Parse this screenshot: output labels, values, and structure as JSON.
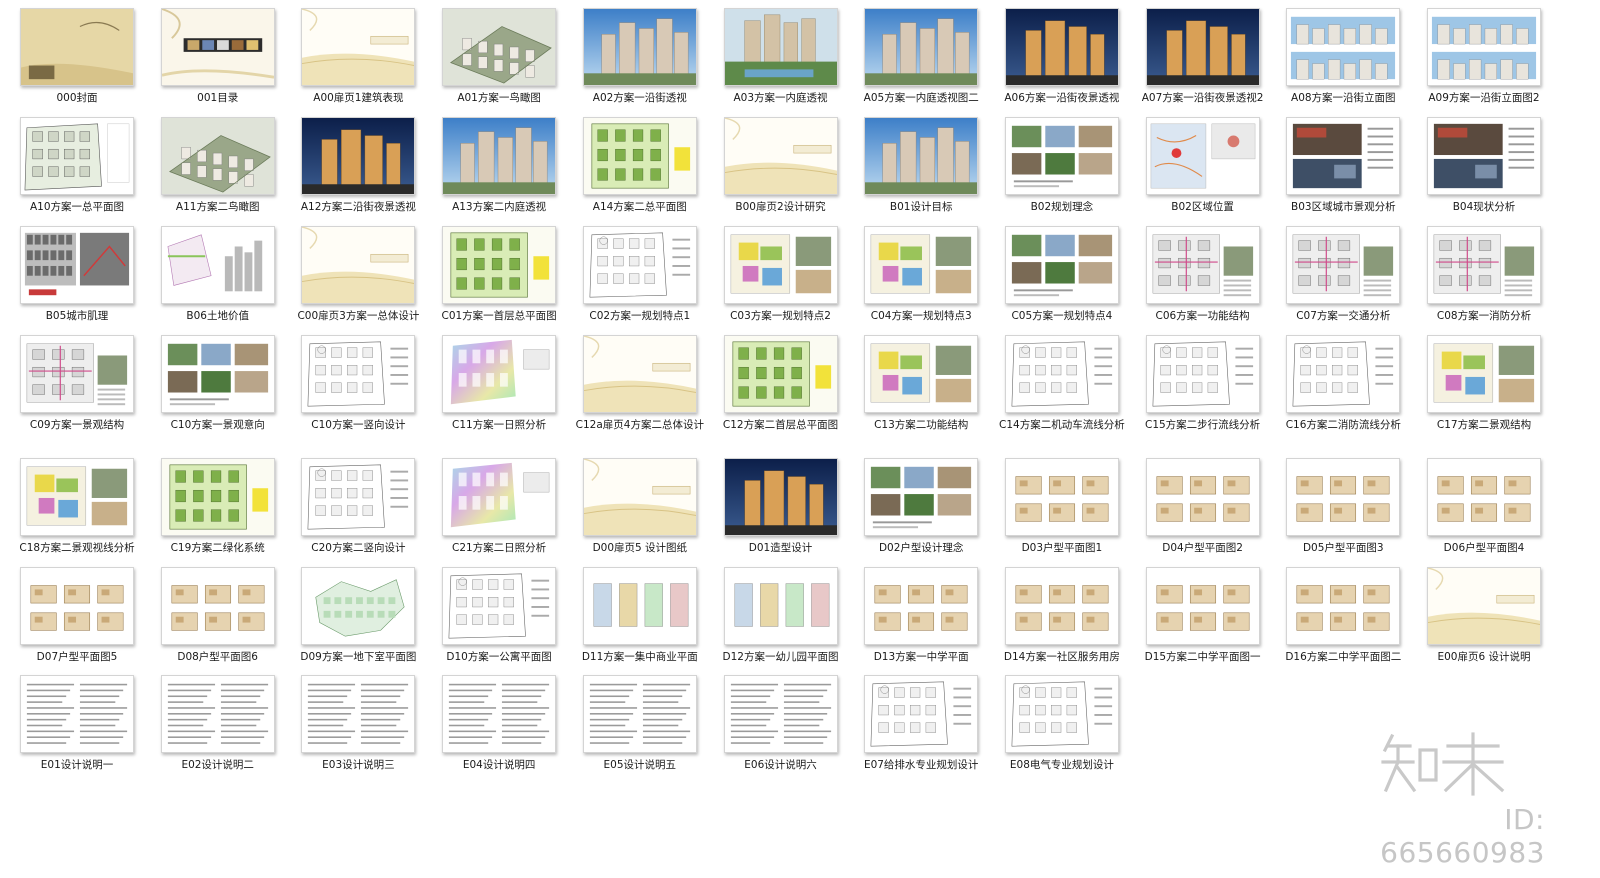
{
  "rows": [
    [
      {
        "label": "000封面",
        "kind": "cover"
      },
      {
        "label": "001目录",
        "kind": "toc"
      },
      {
        "label": "A00扉页1建筑表现",
        "kind": "divider"
      },
      {
        "label": "A01方案一鸟瞰图",
        "kind": "aerial"
      },
      {
        "label": "A02方案一沿街透视",
        "kind": "tower-day"
      },
      {
        "label": "A03方案一内庭透视",
        "kind": "tower-garden"
      },
      {
        "label": "A05方案一内庭透视图二",
        "kind": "tower-day"
      },
      {
        "label": "A06方案一沿街夜景透视",
        "kind": "tower-night"
      },
      {
        "label": "A07方案一沿街夜景透视2",
        "kind": "tower-night"
      },
      {
        "label": "A08方案一沿街立面图",
        "kind": "elevation"
      },
      {
        "label": "A09方案一沿街立面图2",
        "kind": "elevation"
      }
    ],
    [
      {
        "label": "A10方案一总平面图",
        "kind": "siteplan"
      },
      {
        "label": "A11方案二鸟瞰图",
        "kind": "aerial"
      },
      {
        "label": "A12方案二沿街夜景透视",
        "kind": "tower-night"
      },
      {
        "label": "A13方案二内庭透视",
        "kind": "tower-day"
      },
      {
        "label": "A14方案二总平面图",
        "kind": "siteplan-green"
      },
      {
        "label": "B00扉页2设计研究",
        "kind": "divider"
      },
      {
        "label": "B01设计目标",
        "kind": "tower-day"
      },
      {
        "label": "B02规划理念",
        "kind": "photos"
      },
      {
        "label": "B02区域位置",
        "kind": "map"
      },
      {
        "label": "B03区域城市景观分析",
        "kind": "photos-dark"
      },
      {
        "label": "B04现状分析",
        "kind": "photos-dark"
      }
    ],
    [
      {
        "label": "B05城市肌理",
        "kind": "texture"
      },
      {
        "label": "B06土地价值",
        "kind": "landvalue"
      },
      {
        "label": "C00扉页3方案一总体设计",
        "kind": "divider"
      },
      {
        "label": "C01方案一首层总平面图",
        "kind": "siteplan-green"
      },
      {
        "label": "C02方案一规划特点1",
        "kind": "lineplan"
      },
      {
        "label": "C03方案一规划特点2",
        "kind": "analysis-color"
      },
      {
        "label": "C04方案一规划特点3",
        "kind": "analysis-color"
      },
      {
        "label": "C05方案一规划特点4",
        "kind": "photos"
      },
      {
        "label": "C06方案一功能结构",
        "kind": "analysis-plan"
      },
      {
        "label": "C07方案一交通分析",
        "kind": "analysis-plan"
      },
      {
        "label": "C08方案一消防分析",
        "kind": "analysis-plan"
      }
    ],
    [
      {
        "label": "C09方案一景观结构",
        "kind": "analysis-plan"
      },
      {
        "label": "C10方案一景观意向",
        "kind": "photos"
      },
      {
        "label": "C10方案一竖向设计",
        "kind": "lineplan"
      },
      {
        "label": "C11方案一日照分析",
        "kind": "sunlight"
      },
      {
        "label": "C12a扉页4方案二总体设计",
        "kind": "divider"
      },
      {
        "label": "C12方案二首层总平面图",
        "kind": "siteplan-green"
      },
      {
        "label": "C13方案二功能结构",
        "kind": "analysis-color"
      },
      {
        "label": "C14方案二机动车流线分析",
        "kind": "lineplan"
      },
      {
        "label": "C15方案二步行流线分析",
        "kind": "lineplan"
      },
      {
        "label": "C16方案二消防流线分析",
        "kind": "lineplan"
      },
      {
        "label": "C17方案二景观结构",
        "kind": "analysis-color"
      }
    ],
    [
      {
        "label": "C18方案二景观视线分析",
        "kind": "analysis-color"
      },
      {
        "label": "C19方案二绿化系统",
        "kind": "siteplan-green"
      },
      {
        "label": "C20方案二竖向设计",
        "kind": "lineplan"
      },
      {
        "label": "C21方案二日照分析",
        "kind": "sunlight"
      },
      {
        "label": "D00扉页5 设计图纸",
        "kind": "divider"
      },
      {
        "label": "D01造型设计",
        "kind": "tower-night"
      },
      {
        "label": "D02户型设计理念",
        "kind": "photos"
      },
      {
        "label": "D03户型平面图1",
        "kind": "floorplan"
      },
      {
        "label": "D04户型平面图2",
        "kind": "floorplan"
      },
      {
        "label": "D05户型平面图3",
        "kind": "floorplan"
      },
      {
        "label": "D06户型平面图4",
        "kind": "floorplan"
      }
    ],
    [
      {
        "label": "D07户型平面图5",
        "kind": "floorplan"
      },
      {
        "label": "D08户型平面图6",
        "kind": "floorplan"
      },
      {
        "label": "D09方案一地下室平面图",
        "kind": "basement"
      },
      {
        "label": "D10方案一公寓平面图",
        "kind": "lineplan"
      },
      {
        "label": "D11方案一集中商业平面",
        "kind": "colorblocks"
      },
      {
        "label": "D12方案一幼儿园平面图",
        "kind": "colorblocks"
      },
      {
        "label": "D13方案一中学平面",
        "kind": "floorplan"
      },
      {
        "label": "D14方案一社区服务用房",
        "kind": "floorplan"
      },
      {
        "label": "D15方案二中学平面图一",
        "kind": "floorplan"
      },
      {
        "label": "D16方案二中学平面图二",
        "kind": "floorplan"
      },
      {
        "label": "E00扉页6 设计说明",
        "kind": "divider"
      }
    ],
    [
      {
        "label": "E01设计说明一",
        "kind": "text"
      },
      {
        "label": "E02设计说明二",
        "kind": "text"
      },
      {
        "label": "E03设计说明三",
        "kind": "text"
      },
      {
        "label": "E04设计说明四",
        "kind": "text"
      },
      {
        "label": "E05设计说明五",
        "kind": "text"
      },
      {
        "label": "E06设计说明六",
        "kind": "text"
      },
      {
        "label": "E07给排水专业规划设计",
        "kind": "lineplan"
      },
      {
        "label": "E08电气专业规划设计",
        "kind": "lineplan"
      }
    ]
  ],
  "watermark": {
    "logo_text": "知末",
    "id_text": "ID: 665660983"
  }
}
